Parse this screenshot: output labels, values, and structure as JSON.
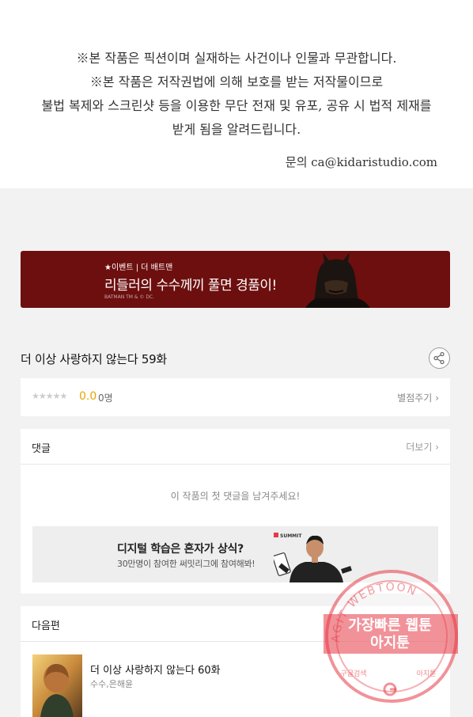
{
  "notice": {
    "lines": [
      "※본 작품은 픽션이며 실재하는 사건이나 인물과 무관합니다.",
      "※본 작품은 저작권법에 의해 보호를 받는 저작물이므로",
      "불법 복제와 스크린샷 등을 이용한 무단 전재 및 유포, 공유 시 법적 제재를",
      "받게 됨을 알려드립니다."
    ],
    "contact": "문의 ca@kidaristudio.com"
  },
  "banner": {
    "tag": "★이벤트 | 더 배트맨",
    "title": "리들러의 수수께끼 풀면 경품이!",
    "copyright": "BATMAN TM & © DC.",
    "bg_color": "#6d0f0f"
  },
  "episode": {
    "title": "더 이상 사랑하지 않는다 59화",
    "share_icon": "share-icon"
  },
  "rating": {
    "stars": "★★★★★",
    "score": "0.0",
    "count": "0명",
    "rate_label": "별점주기",
    "score_color": "#e8a400"
  },
  "comments": {
    "title": "댓글",
    "more_label": "더보기",
    "empty_message": "이 작품의 첫 댓글을 남겨주세요!",
    "ad": {
      "title": "디지털 학습은 혼자가 상식?",
      "subtitle": "30만명이 참여한 써밋리그에 참여해봐!",
      "logo": "SUMMIT"
    }
  },
  "next": {
    "title": "다음편",
    "item": {
      "title": "더 이상 사랑하지 않는다 60화",
      "author": "수수,은해윤"
    }
  },
  "watermark": {
    "arc_text": "AGIT WEBTOON",
    "line1": "가장빠른 웹툰",
    "line2": "아지툰",
    "left_small": "구글검색",
    "right_small": "아지툰",
    "color": "#e63946"
  }
}
